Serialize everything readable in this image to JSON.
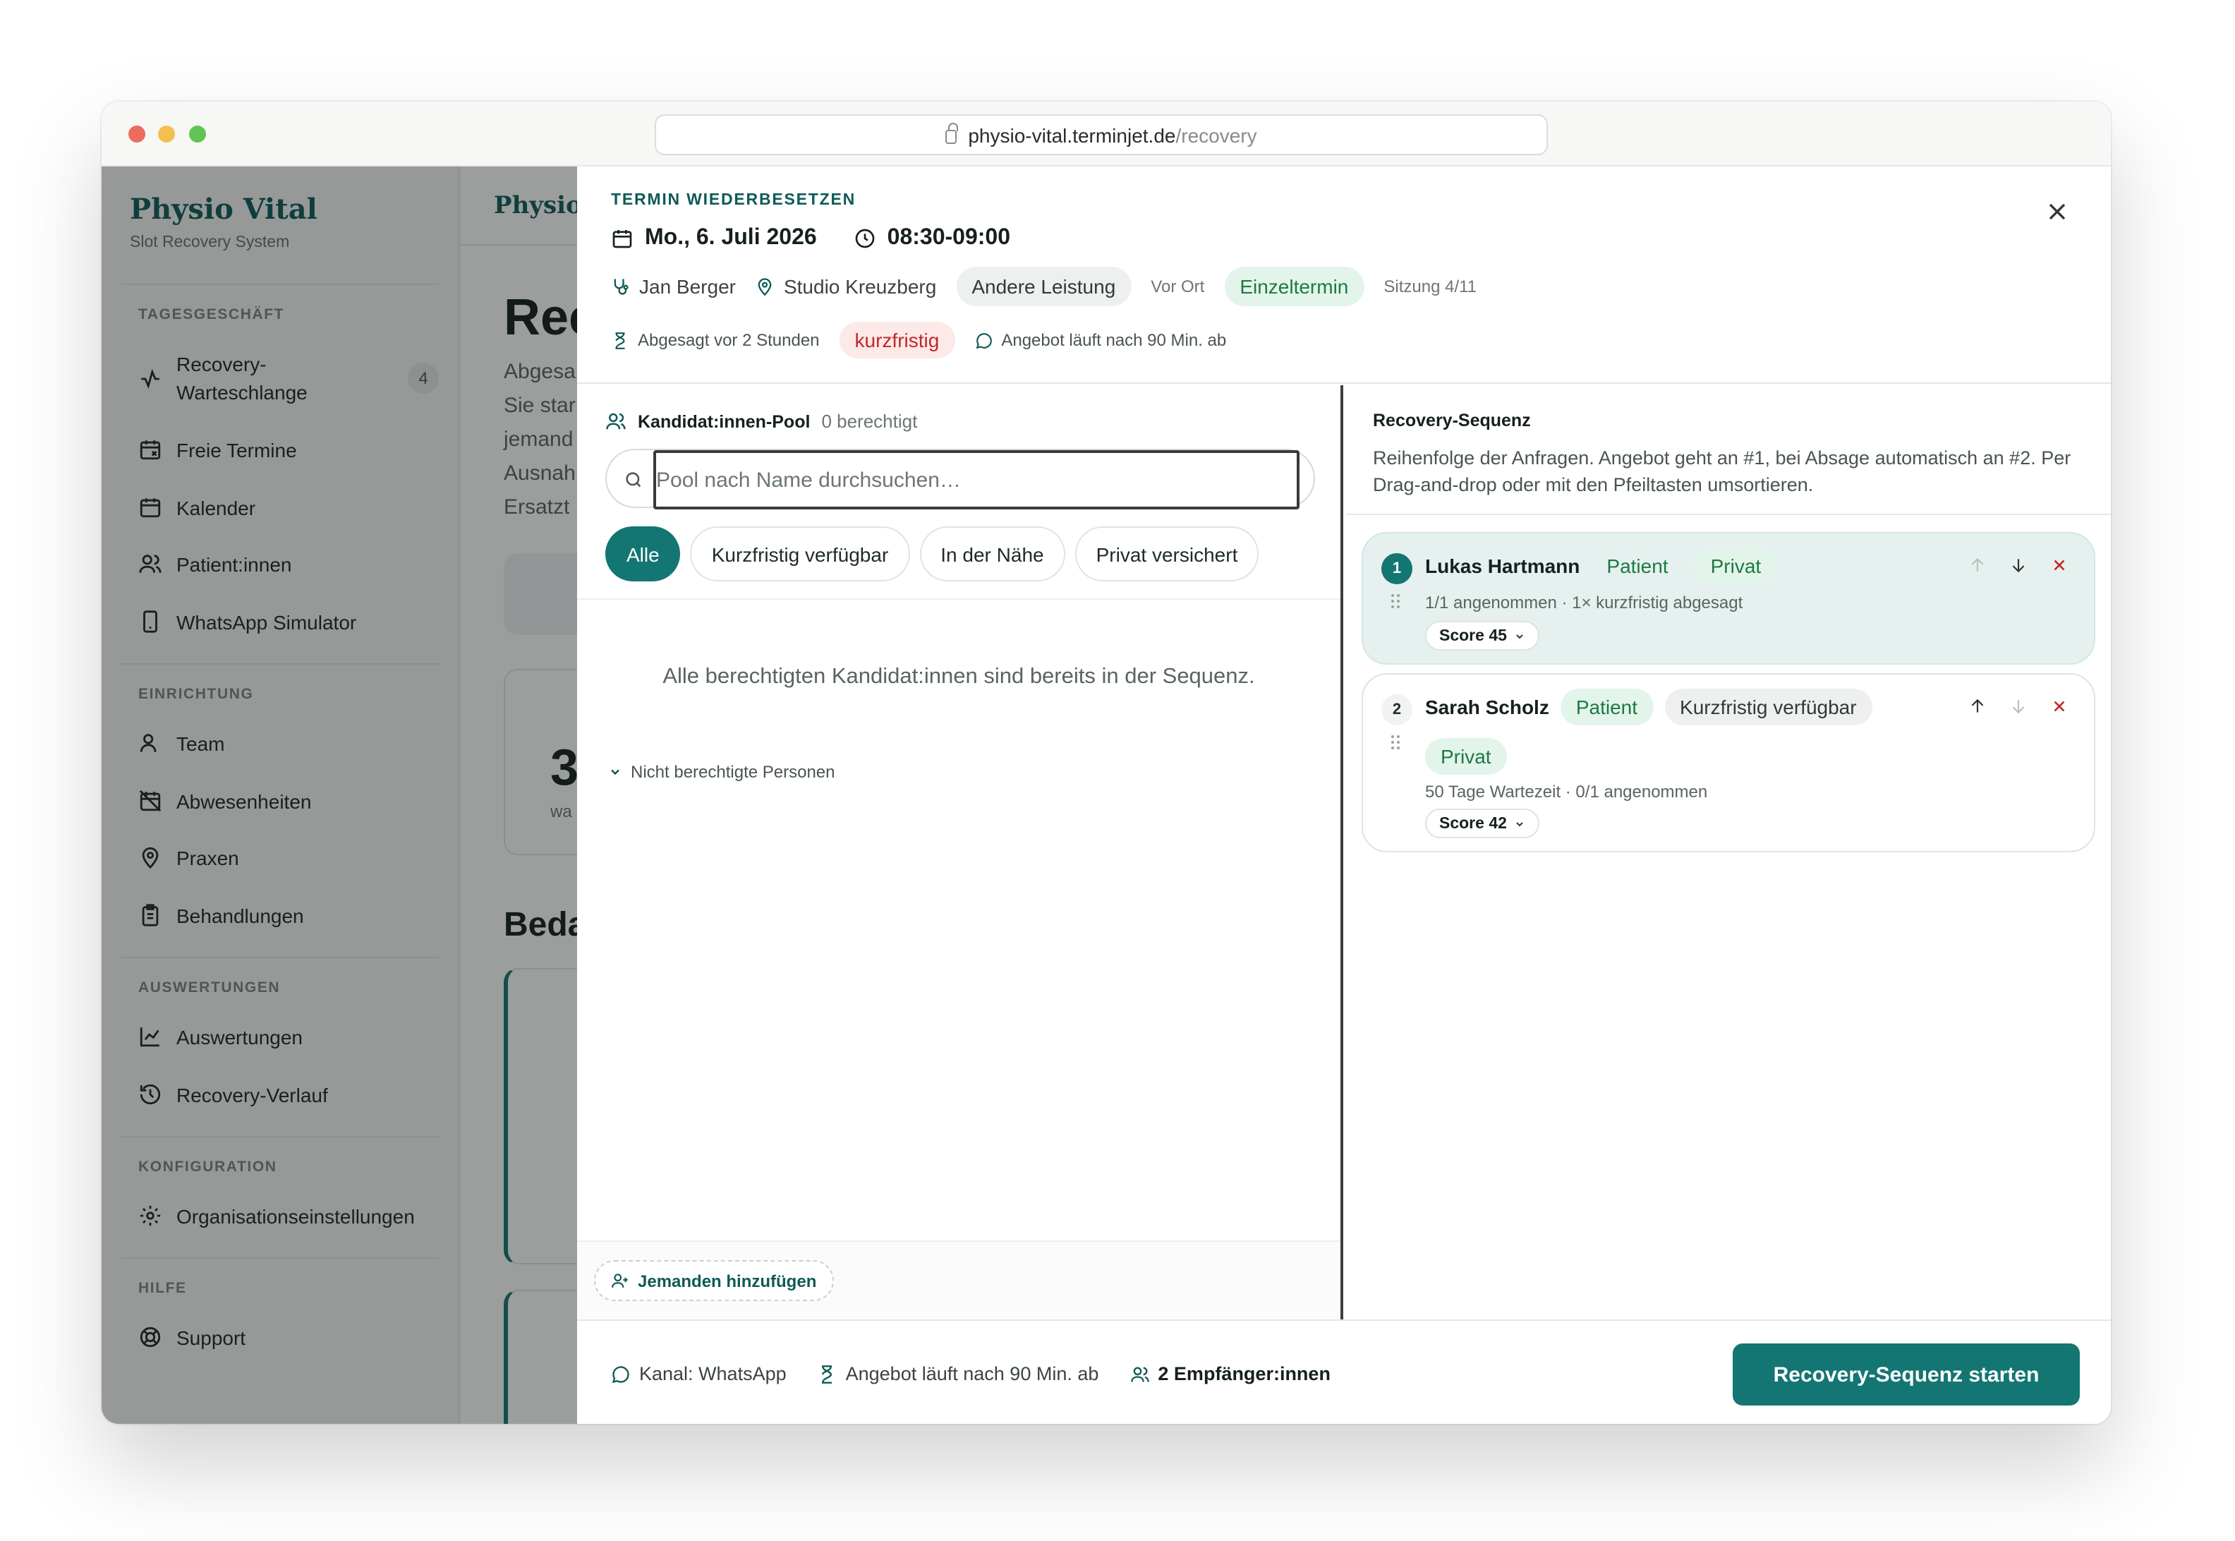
{
  "browser": {
    "url_host": "physio-vital.terminjet.de",
    "url_path": "/recovery"
  },
  "sidebar": {
    "brand": "Physio Vital",
    "subtitle": "Slot Recovery System",
    "sections": [
      {
        "label": "TAGESGESCHÄFT"
      },
      {
        "label": "EINRICHTUNG"
      },
      {
        "label": "AUSWERTUNGEN"
      },
      {
        "label": "KONFIGURATION"
      },
      {
        "label": "HILFE"
      }
    ],
    "items": [
      {
        "label": "Recovery-\nWarteschlange",
        "badge": "4",
        "icon": "activity-icon"
      },
      {
        "label": "Freie Termine",
        "icon": "calendar-x-icon"
      },
      {
        "label": "Kalender",
        "icon": "calendar-icon"
      },
      {
        "label": "Patient:innen",
        "icon": "users-icon"
      },
      {
        "label": "WhatsApp Simulator",
        "icon": "smartphone-icon"
      },
      {
        "label": "Team",
        "icon": "team-icon"
      },
      {
        "label": "Abwesenheiten",
        "icon": "calendar-off-icon"
      },
      {
        "label": "Praxen",
        "icon": "map-pin-icon"
      },
      {
        "label": "Behandlungen",
        "icon": "clipboard-icon"
      },
      {
        "label": "Auswertungen",
        "icon": "chart-icon"
      },
      {
        "label": "Recovery-Verlauf",
        "icon": "history-icon"
      },
      {
        "label": "Organisationseinstellungen",
        "icon": "settings-icon"
      },
      {
        "label": "Support",
        "icon": "lifebuoy-icon"
      }
    ]
  },
  "main": {
    "brand": "Physio",
    "title": "Rec",
    "lede": "Abgesa\nSie star\njemand\nAusnah\nErsatzt",
    "stat_value": "3",
    "stat_label": "wa",
    "section_title": "Beda"
  },
  "modal": {
    "eyebrow": "TERMIN WIEDERBESETZEN",
    "date": "Mo., 6. Juli 2026",
    "time": "08:30-09:00",
    "therapist": "Jan Berger",
    "location": "Studio Kreuzberg",
    "service": "Andere Leistung",
    "mode": "Vor Ort",
    "type": "Einzeltermin",
    "session": "Sitzung 4/11",
    "cancelled": "Abgesagt vor 2 Stunden",
    "urgency": "kurzfristig",
    "offer_expiry": "Angebot läuft nach 90 Min. ab",
    "pool": {
      "title": "Kandidat:innen-Pool",
      "count": "0 berechtigt",
      "search_placeholder": "Pool nach Name durchsuchen…",
      "filters": [
        "Alle",
        "Kurzfristig verfügbar",
        "In der Nähe",
        "Privat versichert"
      ],
      "active_filter": "Alle",
      "empty_message": "Alle berechtigten Kandidat:innen sind bereits in der Sequenz.",
      "not_eligible": "Nicht berechtigte Personen",
      "add_label": "Jemanden hinzufügen"
    },
    "sequence": {
      "title": "Recovery-Sequenz",
      "description": "Reihenfolge der Anfragen. Angebot geht an #1, bei Absage automatisch an #2. Per Drag-and-drop oder mit den Pfeiltasten umsortieren.",
      "entries": [
        {
          "rank": "1",
          "name": "Lukas Hartmann",
          "tags": [
            "Patient",
            "Privat"
          ],
          "detail": "1/1 angenommen · 1× kurzfristig abgesagt",
          "score": "Score 45"
        },
        {
          "rank": "2",
          "name": "Sarah Scholz",
          "tags": [
            "Patient",
            "Kurzfristig verfügbar",
            "Privat"
          ],
          "detail": "50 Tage Wartezeit · 0/1 angenommen",
          "score": "Score 42"
        }
      ]
    },
    "footer": {
      "channel": "Kanal: WhatsApp",
      "expiry": "Angebot läuft nach 90 Min. ab",
      "recipients": "2 Empfänger:innen",
      "start_label": "Recovery-Sequenz starten"
    }
  },
  "colors": {
    "brand": "#137672",
    "success": "#1c7a43",
    "danger": "#c0292a"
  }
}
